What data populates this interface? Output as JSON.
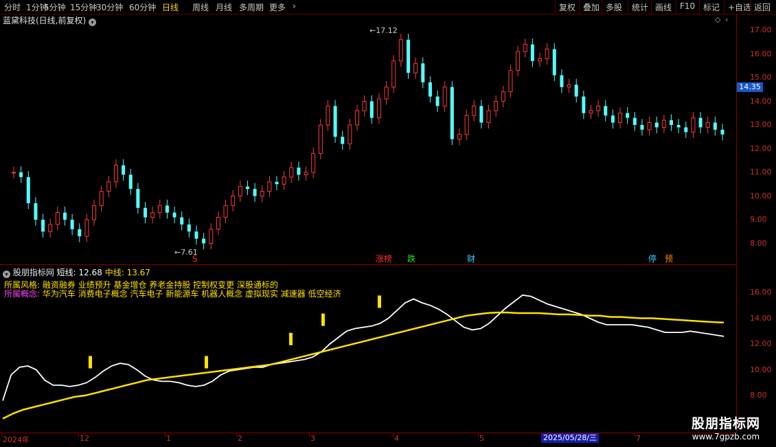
{
  "toolbar": {
    "periods": [
      "分时",
      "1分钟",
      "5分钟",
      "15分钟",
      "30分钟",
      "60分钟",
      "日线",
      "周线",
      "月线",
      "多周期",
      "更多"
    ],
    "active_period": "日线",
    "right_buttons": [
      "复权",
      "叠加",
      "多股",
      "统计",
      "画线",
      "F10",
      "标记",
      "+自选",
      "返回"
    ]
  },
  "chart_title": "蓝黛科技(日线,前复权)",
  "price_axis": [
    "17.00",
    "16.00",
    "15.00",
    "14.00",
    "13.00",
    "12.00",
    "11.00",
    "10.00",
    "9.00",
    "8.00"
  ],
  "current_price": "14.35",
  "high_label": "17.12",
  "low_label": "7.61",
  "events": [
    {
      "text": "S",
      "color": "#ff3030"
    },
    {
      "text": "涨榜",
      "color": "#ff3030"
    },
    {
      "text": "跌",
      "color": "#30e030"
    },
    {
      "text": "财",
      "color": "#40d0ff"
    },
    {
      "text": "停",
      "color": "#40d0ff"
    },
    {
      "text": "预",
      "color": "#ff8c00"
    }
  ],
  "indicator": {
    "name": "股朋指标网",
    "short_label": "短线: 12.68",
    "mid_label": "中线: 13.67",
    "style_label": "所属风格:",
    "style_value": "融资融券 业绩预升 基金增仓 养老金持股 控制权变更 深股通标的",
    "concept_label": "所属概念:",
    "concept_value": "华为汽车 消费电子概念 汽车电子 新能源车 机器人概念 虚拟现实 减速器 低空经济",
    "axis": [
      "16.00",
      "14.00",
      "12.00",
      "10.00",
      "8.00"
    ]
  },
  "dates": [
    "2024年",
    "12",
    "1",
    "2",
    "3",
    "4",
    "5",
    "6",
    "7"
  ],
  "cursor_date": "2025/05/28/三",
  "watermark": {
    "line1": "股朋指标网",
    "line2": "www.7gpzb.com"
  },
  "chart_data": {
    "type": "line",
    "series": [
      {
        "name": "短线",
        "color": "#ffffff",
        "values": [
          7.6,
          9.6,
          10.2,
          10.3,
          10.0,
          9.2,
          8.8,
          8.8,
          8.7,
          8.8,
          9.0,
          9.4,
          9.9,
          10.3,
          10.5,
          10.4,
          10.0,
          9.5,
          9.2,
          9.1,
          9.1,
          9.0,
          8.8,
          8.7,
          8.8,
          9.1,
          9.6,
          9.9,
          10.0,
          10.1,
          10.2,
          10.2,
          10.4,
          10.5,
          10.6,
          10.7,
          10.8,
          11.0,
          11.4,
          12.0,
          12.5,
          13.0,
          13.2,
          13.3,
          13.4,
          13.6,
          14.0,
          14.6,
          15.2,
          15.5,
          15.2,
          15.0,
          14.7,
          14.3,
          13.8,
          13.3,
          13.1,
          13.2,
          13.6,
          14.2,
          14.8,
          15.3,
          15.8,
          15.7,
          15.4,
          15.1,
          14.9,
          14.7,
          14.5,
          14.3,
          14.0,
          13.7,
          13.5,
          13.5,
          13.5,
          13.5,
          13.4,
          13.3,
          13.1,
          12.9,
          12.9,
          12.9,
          13.0,
          12.9,
          12.8,
          12.7,
          12.6
        ]
      },
      {
        "name": "中线",
        "color": "#ffe000",
        "values": [
          6.2,
          6.6,
          6.9,
          7.1,
          7.3,
          7.5,
          7.7,
          7.9,
          8.0,
          8.2,
          8.4,
          8.6,
          8.8,
          9.0,
          9.2,
          9.3,
          9.4,
          9.5,
          9.6,
          9.7,
          9.8,
          9.9,
          10.0,
          10.1,
          10.2,
          10.3,
          10.4,
          10.6,
          10.8,
          11.0,
          11.2,
          11.4,
          11.6,
          11.8,
          12.0,
          12.2,
          12.4,
          12.6,
          12.8,
          13.0,
          13.2,
          13.4,
          13.6,
          13.8,
          14.0,
          14.2,
          14.3,
          14.4,
          14.45,
          14.45,
          14.4,
          14.4,
          14.4,
          14.35,
          14.3,
          14.3,
          14.25,
          14.2,
          14.2,
          14.1,
          14.1,
          14.05,
          14.0,
          14.0,
          13.95,
          13.9,
          13.85,
          13.8,
          13.75,
          13.7,
          13.67
        ]
      }
    ],
    "signals": [
      10.0,
      10.0,
      11.8,
      13.3,
      14.7
    ],
    "ylim": [
      6,
      18
    ]
  },
  "kline": {
    "closes": [
      11.0,
      10.8,
      9.7,
      9.0,
      8.5,
      8.8,
      9.3,
      9.0,
      8.6,
      8.3,
      9.0,
      9.6,
      10.2,
      10.6,
      11.3,
      10.9,
      10.3,
      9.5,
      9.1,
      9.3,
      9.6,
      9.3,
      9.1,
      8.8,
      8.5,
      8.2,
      8.0,
      8.6,
      9.1,
      9.6,
      10.0,
      10.4,
      10.3,
      10.0,
      10.2,
      10.6,
      10.5,
      10.8,
      11.2,
      10.9,
      11.0,
      11.8,
      13.0,
      13.8,
      12.5,
      12.2,
      13.0,
      13.6,
      14.0,
      13.3,
      14.1,
      14.6,
      15.7,
      16.6,
      15.2,
      15.6,
      14.8,
      14.2,
      13.8,
      14.6,
      12.4,
      12.6,
      13.4,
      13.8,
      13.1,
      13.6,
      14.0,
      14.4,
      15.3,
      16.1,
      16.4,
      15.7,
      15.8,
      16.2,
      15.1,
      14.6,
      14.7,
      14.2,
      13.5,
      13.6,
      13.8,
      13.4,
      13.1,
      13.5,
      13.3,
      13.0,
      12.8,
      13.1,
      12.9,
      13.2,
      13.0,
      12.9,
      12.7,
      13.3,
      12.9,
      13.1,
      12.8,
      12.6
    ]
  }
}
